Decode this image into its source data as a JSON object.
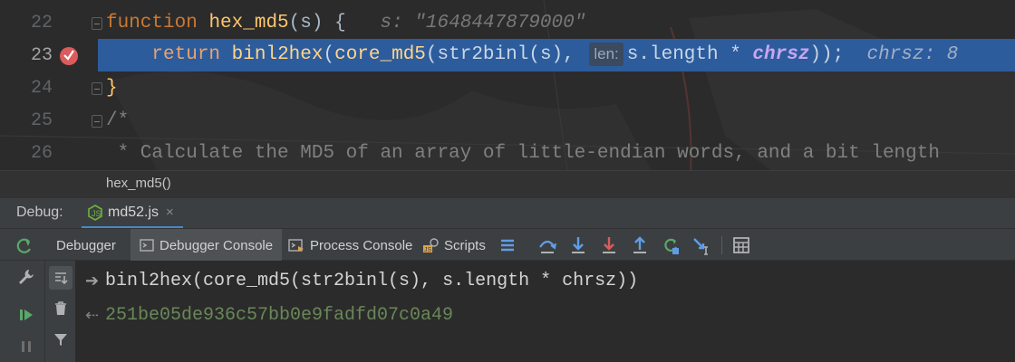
{
  "editor": {
    "lines": [
      {
        "num": "22",
        "code_kw": "function",
        "code_fn": "hex_md5",
        "code_rest": "(s) {",
        "inline_hint": "s: \"1648447879000\""
      },
      {
        "num": "23",
        "kw": "return",
        "fn": "binl2hex",
        "p1": "(",
        "fn2": "core_md5",
        "p2": "(str2binl(s),",
        "param_hint": "len:",
        "p3": "s.length *",
        "ital": "chrsz",
        "p4": "));",
        "inline_hint": "chrsz: 8"
      },
      {
        "num": "24",
        "code": "}"
      },
      {
        "num": "25",
        "code": "/*"
      },
      {
        "num": "26",
        "code": " * Calculate the MD5 of an array of little-endian words, and a bit length"
      }
    ]
  },
  "breadcrumb": {
    "label": "hex_md5()"
  },
  "debug": {
    "label": "Debug:",
    "session_tab": "md52.js",
    "session_close": "×"
  },
  "toolbar": {
    "tabs": [
      "Debugger",
      "Debugger Console",
      "Process Console",
      "Scripts"
    ]
  },
  "console": {
    "input_expr": "binl2hex(core_md5(str2binl(s),",
    "input_expr2": "s.length * chrsz))",
    "result": "251be05de936c57bb0e9fadfd07c0a49"
  },
  "colors": {
    "accent": "#4a88c7",
    "selection": "#2d5c9d",
    "keyword": "#cc7832",
    "function": "#ffc66d",
    "result_green": "#6a8759"
  }
}
